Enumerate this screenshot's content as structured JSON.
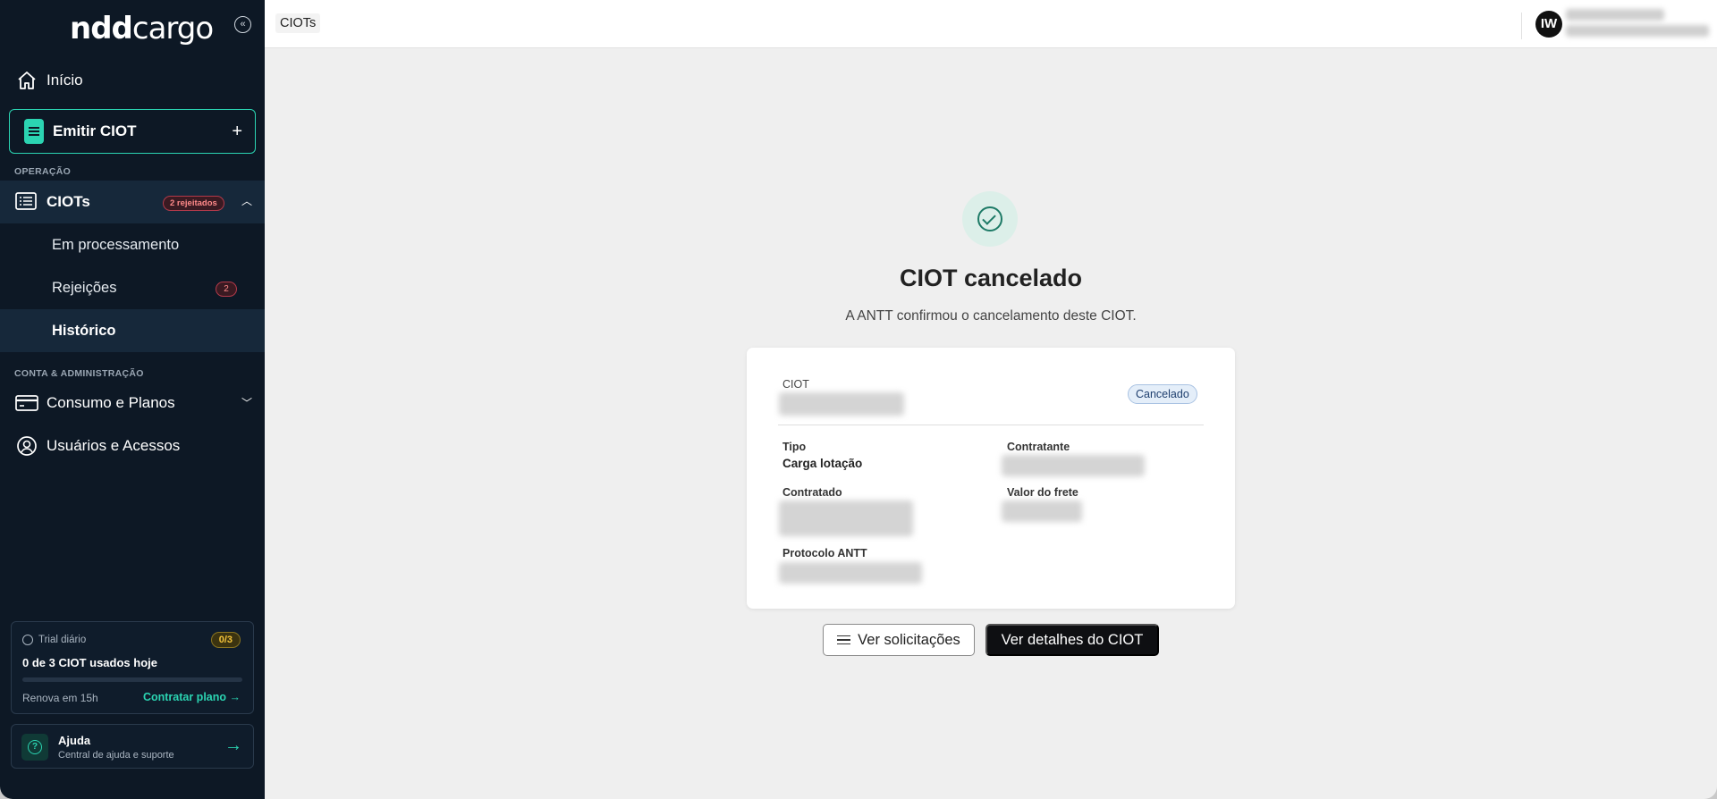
{
  "sidebar": {
    "logo": {
      "bold": "ndd",
      "regular": "cargo"
    },
    "collapse_icon": "double-chevron-left-icon",
    "home_label": "Início",
    "emit_label": "Emitir CIOT",
    "emit_plus": "+",
    "section_operacao": "OPERAÇÃO",
    "ciots_label": "CIOTs",
    "ciots_badge": "2 rejeitados",
    "sub_items": [
      {
        "label": "Em processamento"
      },
      {
        "label": "Rejeições",
        "count": "2"
      },
      {
        "label": "Histórico",
        "active": true
      }
    ],
    "section_conta": "CONTA & ADMINISTRAÇÃO",
    "consumo_label": "Consumo e Planos",
    "usuarios_label": "Usuários e Acessos",
    "trial": {
      "title": "Trial diário",
      "ratio": "0/3",
      "usage": "0 de 3 CIOT usados hoje",
      "progress": 0,
      "renew": "Renova em 15h",
      "cta": "Contratar plano →"
    },
    "help": {
      "title": "Ajuda",
      "subtitle": "Central de ajuda e suporte",
      "arrow": "→",
      "icon": "?"
    }
  },
  "topbar": {
    "breadcrumb": "CIOTs",
    "avatar_initials": "IW"
  },
  "main": {
    "title": "CIOT cancelado",
    "subtitle": "A ANTT confirmou o cancelamento deste CIOT.",
    "card": {
      "ciot_label": "CIOT",
      "status": "Cancelado",
      "tipo_label": "Tipo",
      "tipo_value": "Carga lotação",
      "contratante_label": "Contratante",
      "contratado_label": "Contratado",
      "valor_label": "Valor do frete",
      "protocolo_label": "Protocolo ANTT"
    },
    "btn_solicitacoes": "Ver solicitações",
    "btn_detalhes": "Ver detalhes do CIOT"
  },
  "colors": {
    "sidebar_bg": "#0d1825",
    "accent": "#2bd4b2",
    "danger": "#ff8a8a",
    "success": "#1d7a66"
  }
}
